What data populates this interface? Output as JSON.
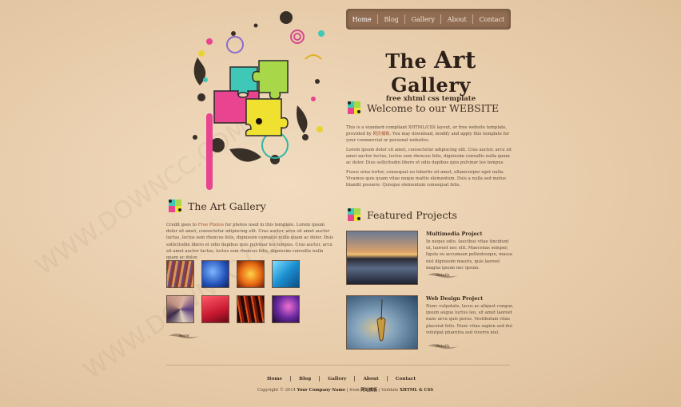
{
  "nav": {
    "items": [
      "Home",
      "Blog",
      "Gallery",
      "About",
      "Contact"
    ]
  },
  "logo": {
    "title_the": "The",
    "title_art": "Art",
    "title_gallery": "Gallery",
    "subtitle": "free xhtml css template"
  },
  "welcome": {
    "heading": "Welcome to our WEBSITE",
    "p1a": "This is a standard compliant XHTML/CSS layout, or free website template, provided by ",
    "p1_link": "网页模板",
    "p1b": ". You may download, modify and apply this template for your commercial or personal websites.",
    "p2": "Lorem ipsum dolor sit amet, consectetur adipiscing elit. Cras auctor, arcu sit amet auctor luctus, lectus sem rhoncus felis, dignissim convallis nulla quam ac dolor. Duis sollicitudin libero et odio dapibus quis pulvinar leo tempus.",
    "p3": "Fusce urna tortor, consequat eu lobortis sit amet, ullamcorper eget nulla. Vivamus quis quam vitae neque mattis elementum. Duis a nulla sed metus blandit posuere. Quisque elementum consequat felis."
  },
  "gallery": {
    "heading": "The Art Gallery",
    "p_a": "Credit goes to ",
    "p_link": "Free Photos",
    "p_b": " for photos used in this template. Lorem ipsum dolor sit amet, consectetur adipiscing elit. Cras auctor, arcu sit amet auctor luctus, lectus sem rhoncus felis, dignissim convallis nulla quam ac dolor. Duis sollicitudin libero et odio dapibus quis pulvinar leo tempus. Cras auctor, arcu sit amet auctor luctus, lectus sem rhoncus felis, dignissim convallis nulla quam ac dolor.",
    "more": "more"
  },
  "featured": {
    "heading": "Featured Projects",
    "projects": [
      {
        "title": "Multimedia Project",
        "text": "In neque odio, faucibus vitae tincidunt ut, laoreet nec elit. Maecenas semper, ligula eu accumsan pellentesque, massa nisl dignissim mauris, quis laoreet magna ipsum nec ipsum.",
        "more": "details"
      },
      {
        "title": "Web Design Project",
        "text": "Nunc vulputate, lacus ac aliquet congue, ipsum augue luctus leo, sit amet laoreet nunc arcu quis purus. Vestibulum vitae placerat felis. Nunc vitae sapien sed dui volutpat pharetra sed viverra nisl.",
        "more": "details"
      }
    ]
  },
  "footer": {
    "links": [
      "Home",
      "Blog",
      "Gallery",
      "About",
      "Contact"
    ],
    "copy_a": "Copyright © 2014 ",
    "company": "Your Company Name",
    "copy_b": " | from ",
    "from_name": "网站模板",
    "copy_c": " | Validate ",
    "validate": "XHTML & CSS"
  },
  "watermark": "WWW.DOWNCC.COM",
  "colors": {
    "nav_bg": "#8f6c52",
    "page_bg": "#e8cfae",
    "link": "#a1502c"
  }
}
